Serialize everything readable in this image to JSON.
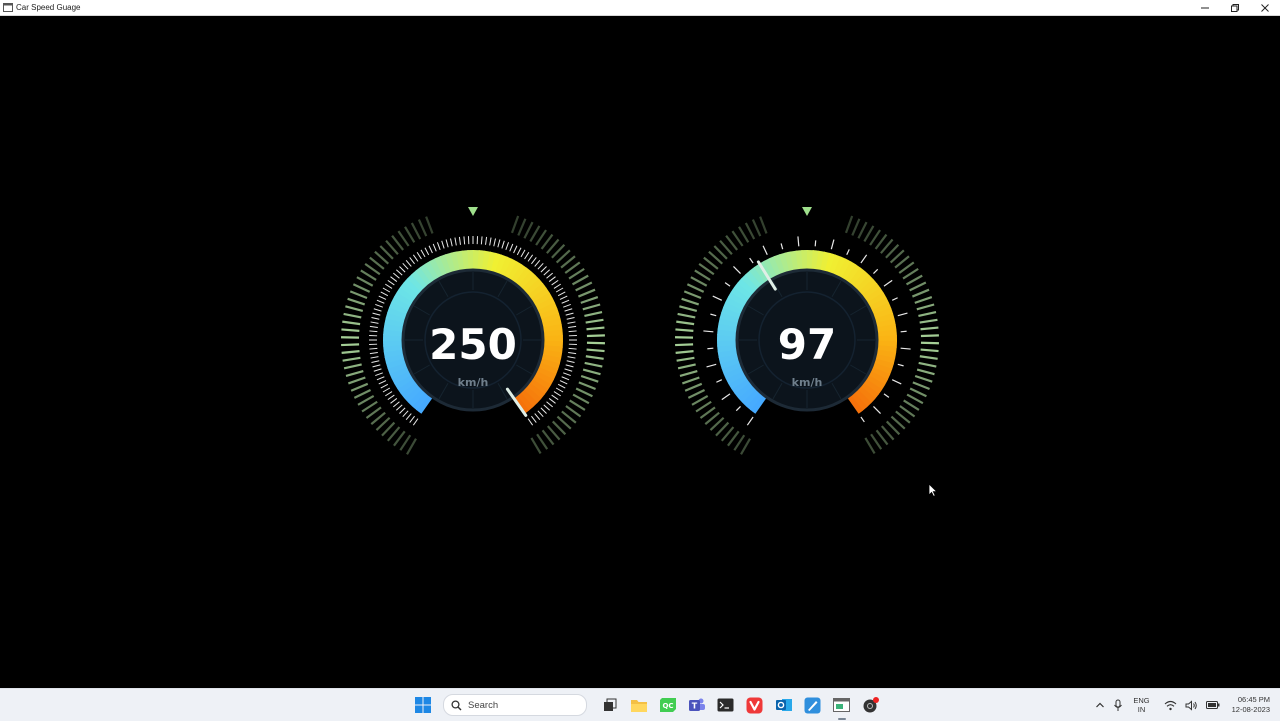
{
  "window": {
    "title": "Car Speed Guage"
  },
  "gauges": [
    {
      "value": "250",
      "unit": "km/h",
      "level": 1.0
    },
    {
      "value": "97",
      "unit": "km/h",
      "level": 0.39
    }
  ],
  "taskbar": {
    "search_placeholder": "Search",
    "lang_top": "ENG",
    "lang_bottom": "IN",
    "time": "06:45 PM",
    "date": "12-08-2023"
  }
}
